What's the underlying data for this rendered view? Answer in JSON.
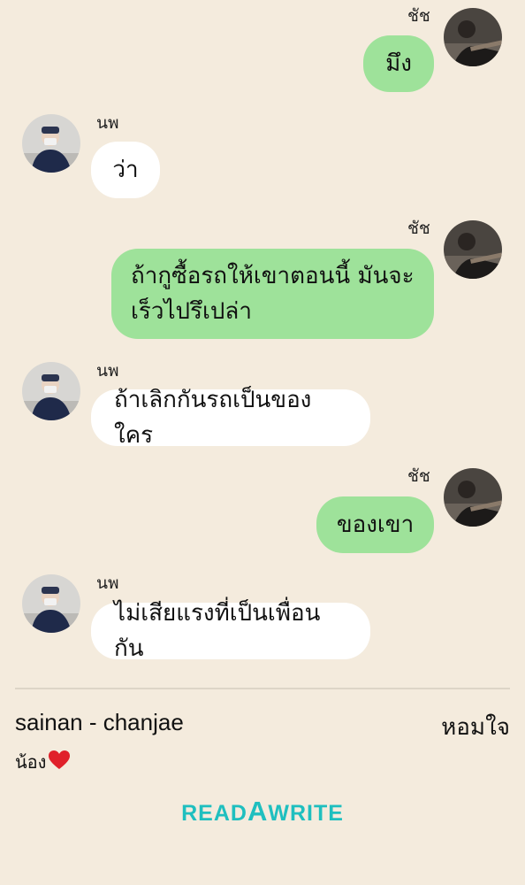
{
  "messages": [
    {
      "sender": "ชัช",
      "side": "me",
      "text": "มึง"
    },
    {
      "sender": "นพ",
      "side": "them",
      "text": "ว่า"
    },
    {
      "sender": "ชัช",
      "side": "me",
      "text_lines": [
        "ถ้ากูซื้อรถให้เขาตอนนี้ มันจะ",
        "เร็วไปรึเปล่า"
      ]
    },
    {
      "sender": "นพ",
      "side": "them",
      "text": "ถ้าเลิกกันรถเป็นของใคร"
    },
    {
      "sender": "ชัช",
      "side": "me",
      "text": "ของเขา"
    },
    {
      "sender": "นพ",
      "side": "them",
      "text": "ไม่เสียแรงที่เป็นเพื่อนกัน"
    }
  ],
  "footer": {
    "title": "sainan - chanjae",
    "right_label": "หอมใจ",
    "note": "น้อง"
  },
  "logo": {
    "part1": "READ",
    "part2": "A",
    "part3": "WRITE"
  },
  "colors": {
    "background": "#f4ebdd",
    "my_bubble": "#9ee29a",
    "their_bubble": "#ffffff",
    "logo": "#1fbfbf",
    "heart": "#e0202a"
  }
}
